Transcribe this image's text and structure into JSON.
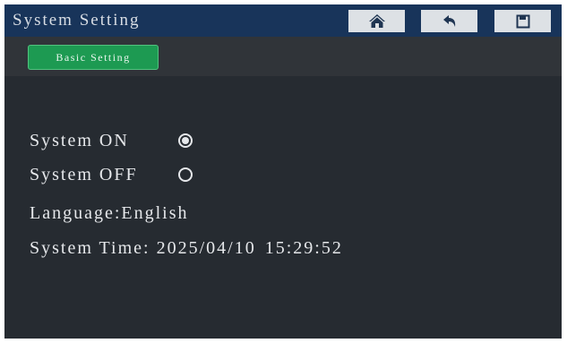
{
  "window": {
    "title": "System Setting"
  },
  "toolbar": {
    "home_icon": "home-icon",
    "back_icon": "back-arrow-icon",
    "save_icon": "save-disk-icon"
  },
  "tabs": [
    {
      "label": "Basic Setting",
      "active": true
    }
  ],
  "settings": {
    "system_on_label": "System ON",
    "system_on_selected": true,
    "system_off_label": "System OFF",
    "system_off_selected": false,
    "language_label": "Language:",
    "language_value": "English",
    "time_label": "System Time:",
    "time_date": "2025/04/10",
    "time_clock": "15:29:52"
  },
  "colors": {
    "titlebar": "#18345a",
    "background": "#262b31",
    "tab_active": "#1d9a52"
  }
}
